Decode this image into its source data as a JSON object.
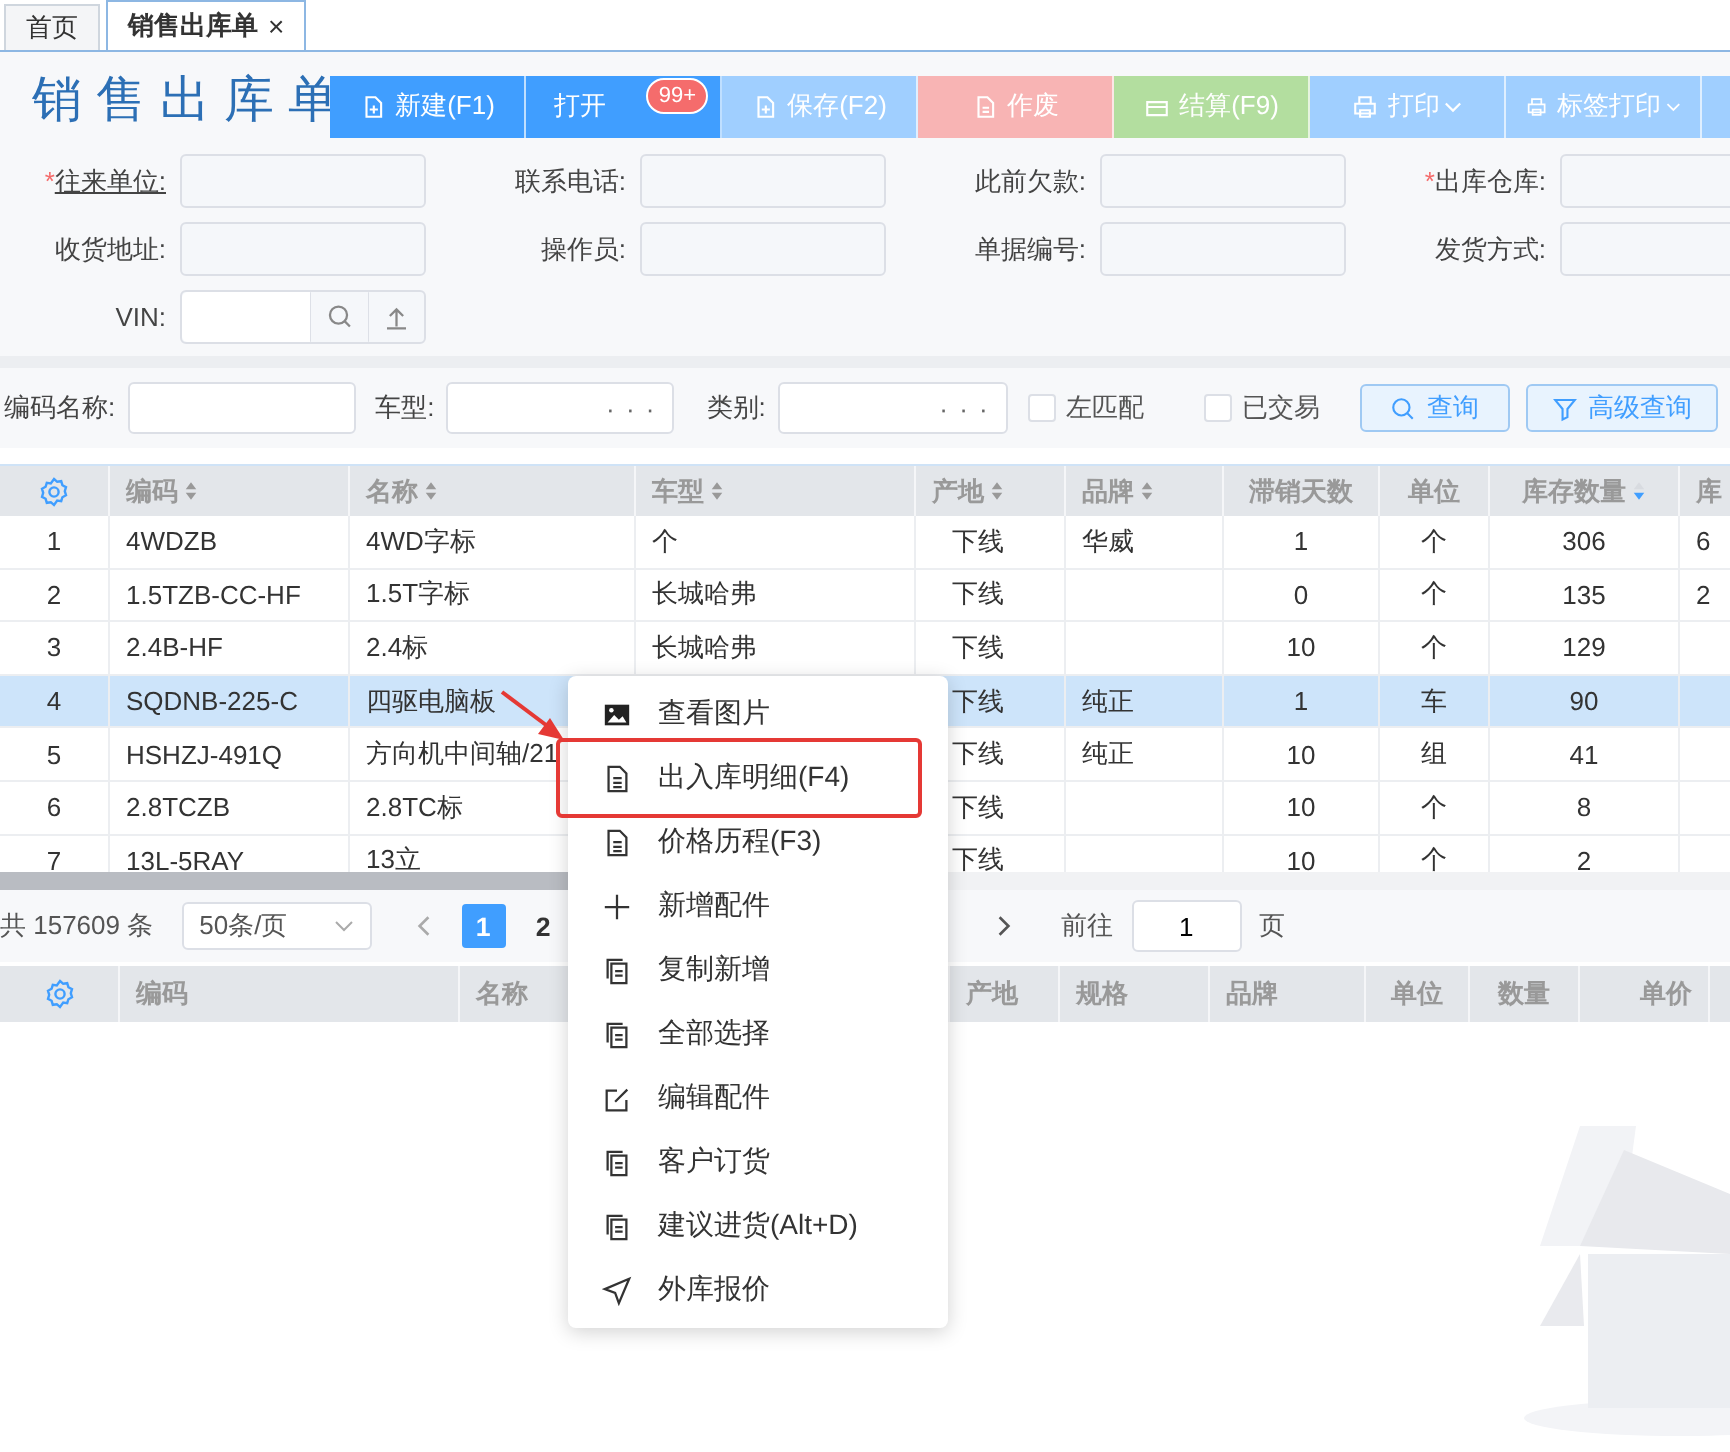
{
  "tabs": [
    {
      "label": "首页",
      "selected": false
    },
    {
      "label": "销售出库单",
      "selected": true,
      "close": "×"
    }
  ],
  "title": "销售出库单",
  "toolbar": [
    {
      "label": "新建(F1)",
      "kind": "new",
      "color": "#409eff"
    },
    {
      "label": "打开",
      "kind": "open",
      "color": "#409eff",
      "badge": "99+"
    },
    {
      "label": "保存(F2)",
      "kind": "new",
      "color": "#a0cfff"
    },
    {
      "label": "作废",
      "kind": "doc",
      "color": "#f8b4b4"
    },
    {
      "label": "结算(F9)",
      "kind": "wallet",
      "color": "#b3de9f"
    },
    {
      "label": "打印",
      "kind": "print",
      "color": "#a0cfff",
      "dropdown": true
    },
    {
      "label": "标签打印",
      "kind": "print",
      "color": "#a0cfff",
      "dropdown": true
    }
  ],
  "form": [
    [
      {
        "label": "往来单位:",
        "mark": "*",
        "underlined": true
      },
      {
        "label": "联系电话:"
      },
      {
        "label": "此前欠款:"
      },
      {
        "label": "出库仓库:",
        "mark": "*"
      }
    ],
    [
      {
        "label": "收货地址:"
      },
      {
        "label": "操作员:"
      },
      {
        "label": "单据编号:"
      },
      {
        "label": "发货方式:"
      }
    ]
  ],
  "vin": {
    "label": "VIN:"
  },
  "filters": {
    "inputs": [
      {
        "label": "编码名称:"
      },
      {
        "label": "车型:",
        "more": "· · ·"
      },
      {
        "label": "类别:",
        "more": "· · ·"
      }
    ],
    "checks": [
      {
        "label": "左匹配",
        "checked": false
      },
      {
        "label": "已交易",
        "checked": false
      }
    ],
    "buttons": [
      {
        "label": "查询",
        "kind": "search"
      },
      {
        "label": "高级查询",
        "kind": "filter"
      }
    ]
  },
  "table": {
    "columns": [
      {
        "label": "编码",
        "sorted": false
      },
      {
        "label": "名称",
        "sorted": false
      },
      {
        "label": "车型",
        "sorted": false
      },
      {
        "label": "产地",
        "sorted": false
      },
      {
        "label": "品牌",
        "sorted": false
      },
      {
        "label": "滞销天数"
      },
      {
        "label": "单位"
      },
      {
        "label": "库存数量",
        "sorted": true
      },
      {
        "label": "库"
      }
    ],
    "rows": [
      {
        "no": "1",
        "code": "4WDZB",
        "name": "4WD字标",
        "model": "个",
        "origin": "下线",
        "brand": "华威",
        "days": "1",
        "unit": "个",
        "stock": "306",
        "column_10": "6",
        "selected": false
      },
      {
        "no": "2",
        "code": "1.5TZB-CC-HF",
        "name": "1.5T字标",
        "model": "长城哈弗",
        "origin": "下线",
        "days": "0",
        "unit": "个",
        "stock": "135",
        "column_10": "2",
        "selected": false
      },
      {
        "no": "3",
        "code": "2.4B-HF",
        "name": "2.4标",
        "model": "长城哈弗",
        "origin": "下线",
        "days": "10",
        "unit": "个",
        "stock": "129",
        "selected": false
      },
      {
        "no": "4",
        "code": "SQDNB-225-C",
        "name": "四驱电脑板",
        "origin": "下线",
        "brand": "纯正",
        "days": "1",
        "unit": "车",
        "stock": "90",
        "selected": true
      },
      {
        "no": "5",
        "code": "HSHZJ-491Q",
        "name": "方向机中间轴/21",
        "origin": "下线",
        "brand": "纯正",
        "days": "10",
        "unit": "组",
        "stock": "41",
        "selected": false
      },
      {
        "no": "6",
        "code": "2.8TCZB",
        "name": "2.8TC标",
        "origin": "下线",
        "days": "10",
        "unit": "个",
        "stock": "8",
        "selected": false
      },
      {
        "no": "7",
        "code": "13L-5RAY",
        "name": "13立",
        "origin": "下线",
        "days": "10",
        "unit": "个",
        "stock": "2",
        "selected": false
      }
    ]
  },
  "pager": {
    "total": "共 157609 条",
    "page_size": "50条/页",
    "pages": [
      {
        "label": "1",
        "selected": true
      },
      {
        "label": "2",
        "selected": false
      }
    ],
    "goto": "前往",
    "goto_value": "1",
    "goto_suffix": "页"
  },
  "detail_table": {
    "columns": [
      {
        "label": "编码"
      },
      {
        "label": "名称"
      },
      {
        "label": "产地"
      },
      {
        "label": "规格"
      },
      {
        "label": "品牌"
      },
      {
        "label": "单位"
      },
      {
        "label": "数量"
      },
      {
        "label": "单价"
      }
    ]
  },
  "menu": {
    "items": [
      {
        "label": "查看图片",
        "kind": "image",
        "highlighted": false
      },
      {
        "label": "出入库明细(F4)",
        "kind": "document",
        "highlighted": true
      },
      {
        "label": "价格历程(F3)",
        "kind": "document",
        "highlighted": false
      },
      {
        "label": "新增配件",
        "kind": "add",
        "highlighted": false
      },
      {
        "label": "复制新增",
        "kind": "copy",
        "highlighted": false
      },
      {
        "label": "全部选择",
        "kind": "copy",
        "highlighted": false
      },
      {
        "label": "编辑配件",
        "kind": "edit",
        "highlighted": false
      },
      {
        "label": "客户订货",
        "kind": "copy",
        "highlighted": false
      },
      {
        "label": "建议进货(Alt+D)",
        "kind": "copy",
        "highlighted": false
      },
      {
        "label": "外库报价",
        "kind": "send",
        "highlighted": false
      }
    ]
  }
}
